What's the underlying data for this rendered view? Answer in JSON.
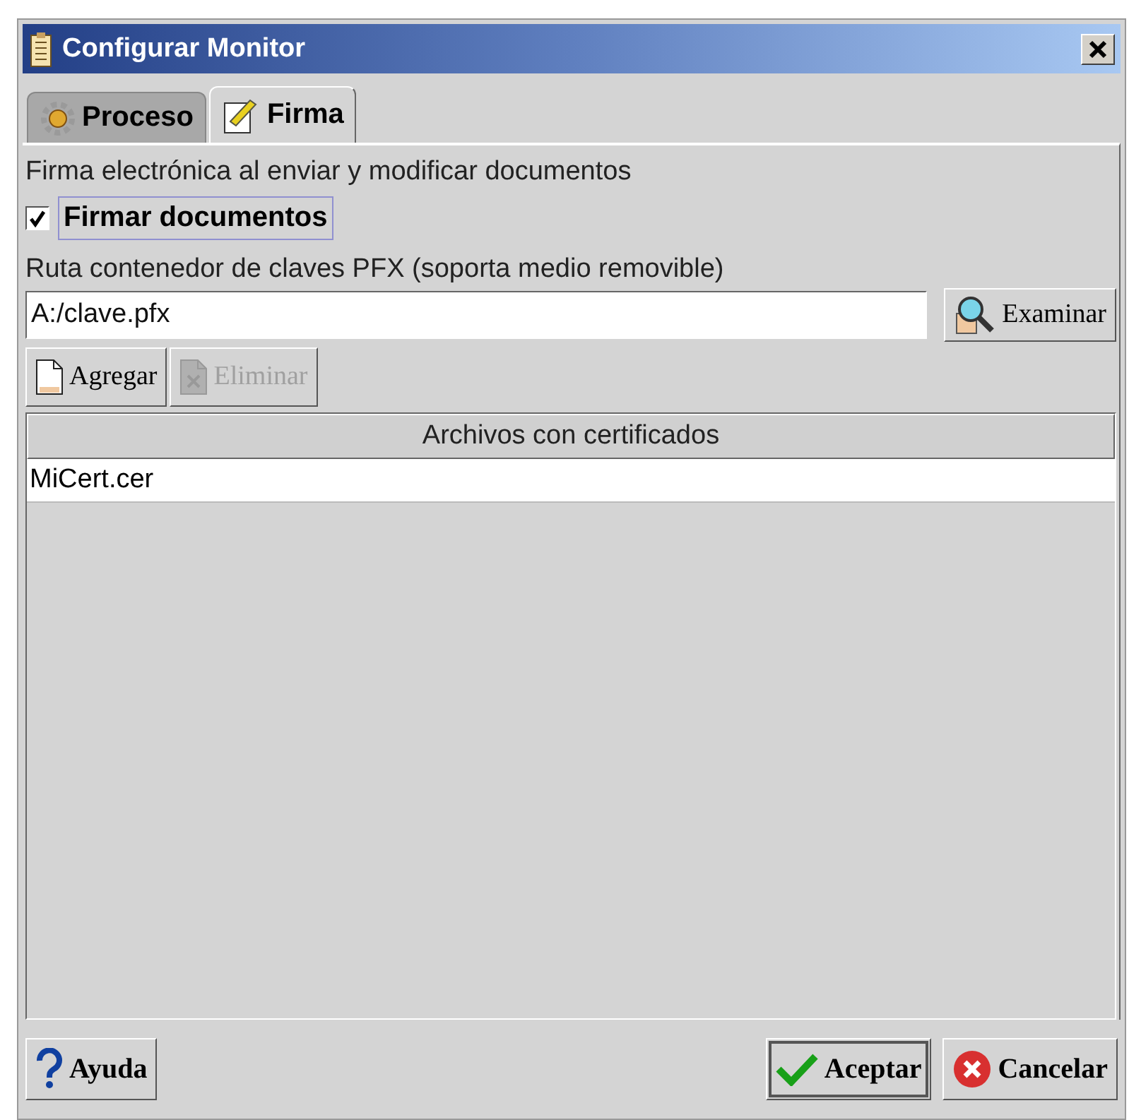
{
  "window": {
    "title": "Configurar Monitor"
  },
  "tabs": [
    {
      "label": "Proceso",
      "selected": false
    },
    {
      "label": "Firma",
      "selected": true
    }
  ],
  "section_label": "Firma electrónica al enviar y modificar documentos",
  "sign_checkbox": {
    "label": "Firmar documentos",
    "checked": true
  },
  "path_label": "Ruta contenedor de claves PFX (soporta medio removible)",
  "path_field": {
    "value": "A:/clave.pfx"
  },
  "browse_button": "Examinar",
  "list_buttons": [
    {
      "label": "Agregar",
      "disabled": false
    },
    {
      "label": "Eliminar",
      "disabled": true
    }
  ],
  "table": {
    "columns": [
      "Archivos con certificados"
    ],
    "rows": [
      [
        "MiCert.cer"
      ]
    ]
  },
  "footer_buttons": [
    {
      "kind": "help",
      "label": "Ayuda"
    },
    {
      "kind": "ok",
      "label": "Aceptar"
    },
    {
      "kind": "cancel",
      "label": "Cancelar"
    }
  ]
}
